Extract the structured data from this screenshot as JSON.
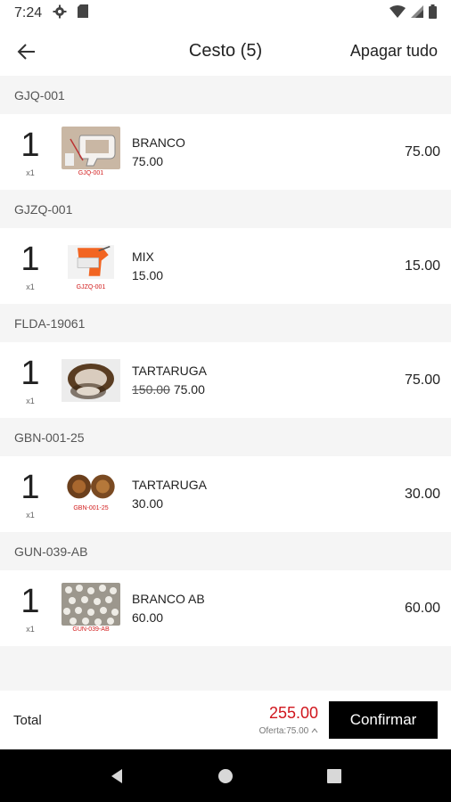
{
  "status": {
    "time": "7:24"
  },
  "header": {
    "title": "Cesto (5)",
    "clear_all": "Apagar tudo"
  },
  "groups": [
    {
      "code": "GJQ-001",
      "qty": "1",
      "unit": "x1",
      "thumb_code": "GJQ-001",
      "variant": "BRANCO",
      "old_price": "",
      "price": "75.00",
      "line_total": "75.00",
      "thumb_icon": "tag-gun-white-icon"
    },
    {
      "code": "GJZQ-001",
      "qty": "1",
      "unit": "x1",
      "thumb_code": "GJZQ-001",
      "variant": "MIX",
      "old_price": "",
      "price": "15.00",
      "line_total": "15.00",
      "thumb_icon": "tag-gun-orange-icon"
    },
    {
      "code": "FLDA-19061",
      "qty": "1",
      "unit": "x1",
      "thumb_code": "",
      "variant": "TARTARUGA",
      "old_price": "150.00",
      "price": "75.00",
      "line_total": "75.00",
      "thumb_icon": "tortoise-frame-icon"
    },
    {
      "code": "GBN-001-25",
      "qty": "1",
      "unit": "x1",
      "thumb_code": "GBN-001-25",
      "variant": "TARTARUGA",
      "old_price": "",
      "price": "30.00",
      "line_total": "30.00",
      "thumb_icon": "tortoise-buttons-icon"
    },
    {
      "code": "GUN-039-AB",
      "qty": "1",
      "unit": "x1",
      "thumb_code": "GUN-039-AB",
      "variant": "BRANCO AB",
      "old_price": "",
      "price": "60.00",
      "line_total": "60.00",
      "thumb_icon": "pearl-beads-icon"
    }
  ],
  "footer": {
    "total_label": "Total",
    "total_amount": "255.00",
    "offer": "Oferta:75.00",
    "confirm": "Confirmar"
  },
  "colors": {
    "accent_red": "#d0161d",
    "confirm_bg": "#000000"
  }
}
